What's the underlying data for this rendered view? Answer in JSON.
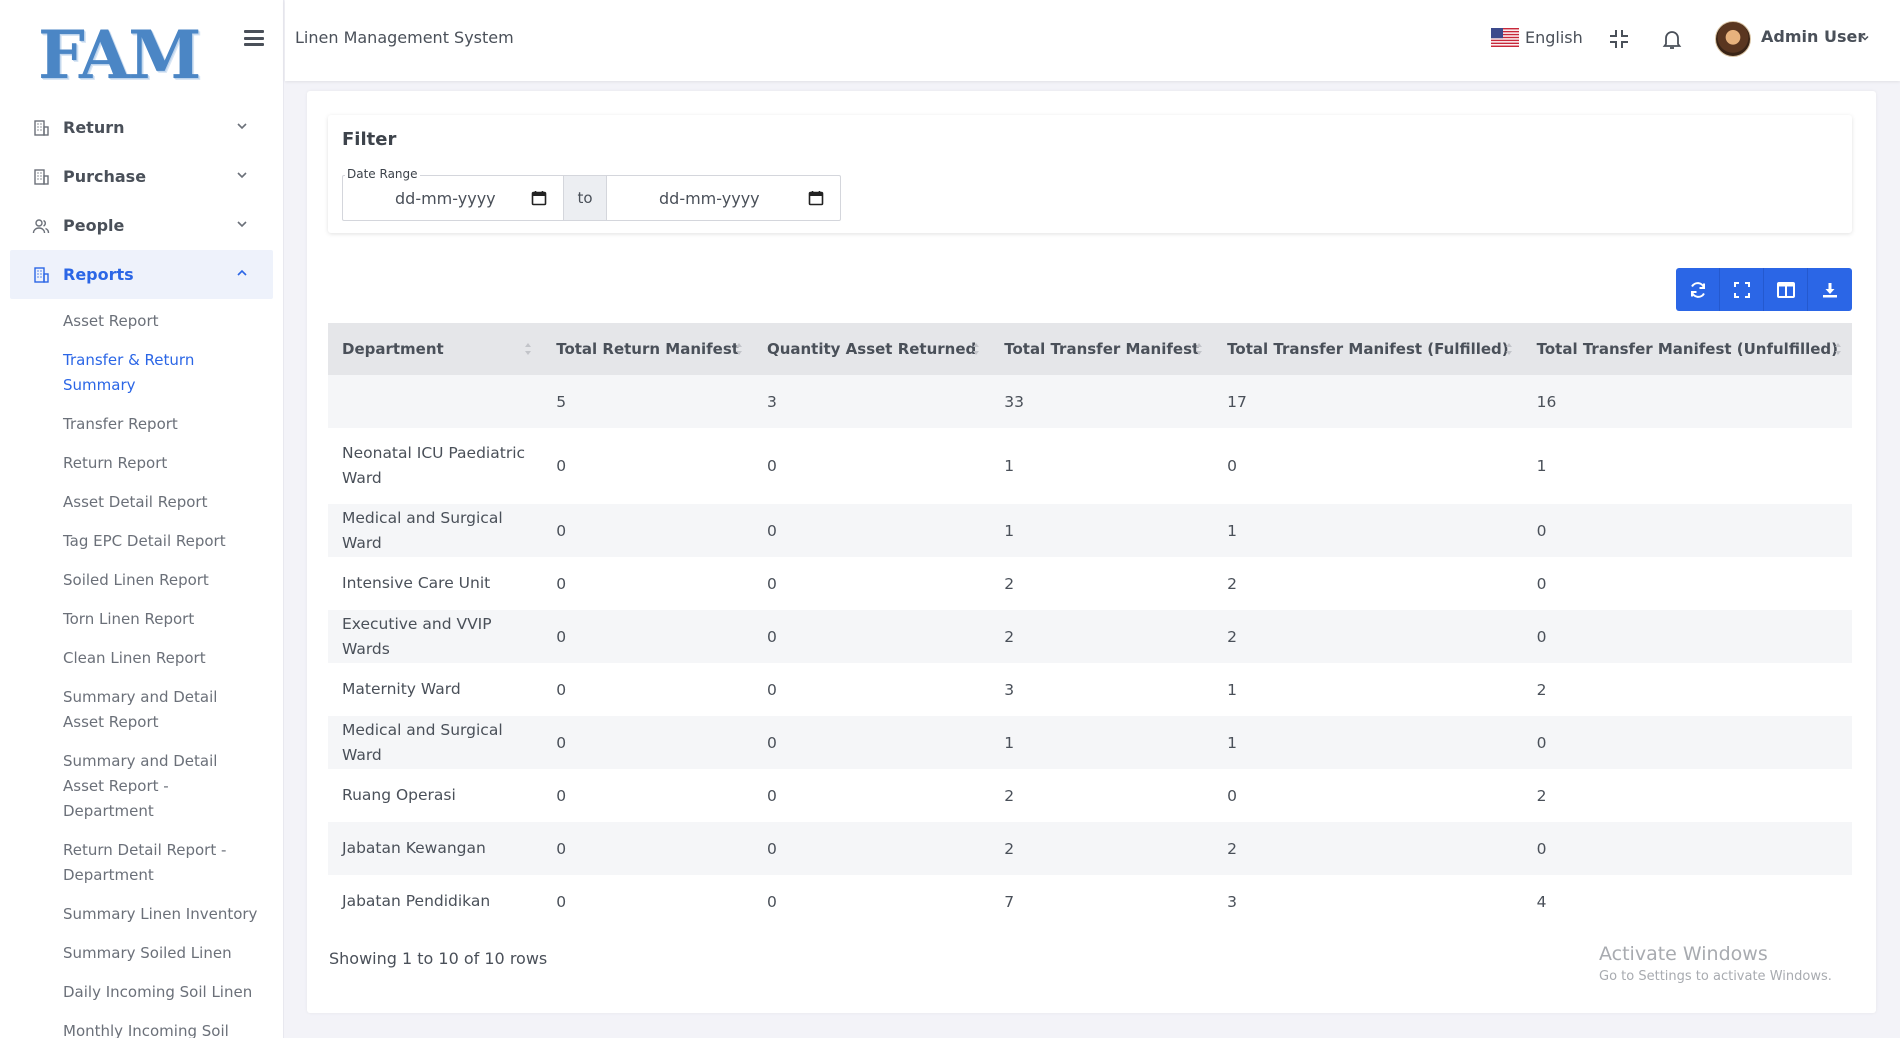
{
  "brand": {
    "logo_text": "FAM"
  },
  "sidebar": {
    "items": [
      {
        "label": "Return",
        "icon": "building-icon"
      },
      {
        "label": "Purchase",
        "icon": "building-icon"
      },
      {
        "label": "People",
        "icon": "people-icon"
      },
      {
        "label": "Reports",
        "icon": "building-icon",
        "active": true
      }
    ],
    "reports_sub": [
      "Asset Report",
      "Transfer & Return Summary",
      "Transfer Report",
      "Return Report",
      "Asset Detail Report",
      "Tag EPC Detail Report",
      "Soiled Linen Report",
      "Torn Linen Report",
      "Clean Linen Report",
      "Summary and Detail Asset Report",
      "Summary and Detail Asset Report - Department",
      "Return Detail Report - Department",
      "Summary Linen Inventory",
      "Summary Soiled Linen",
      "Daily Incoming Soil Linen",
      "Monthly Incoming Soil"
    ]
  },
  "header": {
    "app_title": "Linen Management System",
    "language": "English",
    "user_name": "Admin User"
  },
  "filter": {
    "title": "Filter",
    "date_range_label": "Date Range",
    "from_placeholder": "dd-mm-yyyy",
    "to_label": "to",
    "to_placeholder": "dd-mm-yyyy"
  },
  "table": {
    "columns": [
      "Department",
      "Total Return Manifest",
      "Quantity Asset Returned",
      "Total Transfer Manifest",
      "Total Transfer Manifest (Fulfilled)",
      "Total Transfer Manifest (Unfulfilled)"
    ],
    "rows": [
      [
        "",
        "5",
        "3",
        "33",
        "17",
        "16"
      ],
      [
        "Neonatal ICU Paediatric Ward",
        "0",
        "0",
        "1",
        "0",
        "1"
      ],
      [
        "Medical and Surgical Ward",
        "0",
        "0",
        "1",
        "1",
        "0"
      ],
      [
        "Intensive Care Unit",
        "0",
        "0",
        "2",
        "2",
        "0"
      ],
      [
        "Executive and VVIP Wards",
        "0",
        "0",
        "2",
        "2",
        "0"
      ],
      [
        "Maternity Ward",
        "0",
        "0",
        "3",
        "1",
        "2"
      ],
      [
        "Medical and Surgical Ward",
        "0",
        "0",
        "1",
        "1",
        "0"
      ],
      [
        "Ruang Operasi",
        "0",
        "0",
        "2",
        "0",
        "2"
      ],
      [
        "Jabatan Kewangan",
        "0",
        "0",
        "2",
        "2",
        "0"
      ],
      [
        "Jabatan Pendidikan",
        "0",
        "0",
        "7",
        "3",
        "4"
      ]
    ],
    "footer": "Showing 1 to 10 of 10 rows"
  },
  "watermark": {
    "line1": "Activate Windows",
    "line2": "Go to Settings to activate Windows."
  },
  "colors": {
    "accent": "#2b66e6",
    "logo": "#4b86c5"
  }
}
